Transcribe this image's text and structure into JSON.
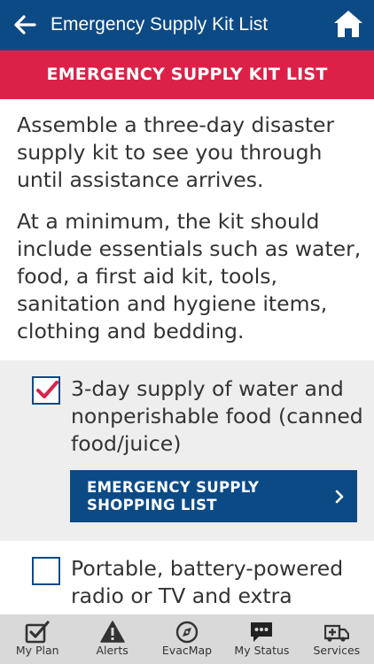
{
  "header": {
    "title": "Emergency Supply Kit List"
  },
  "banner": {
    "text": "EMERGENCY SUPPLY KIT LIST"
  },
  "intro": {
    "paragraph1": "Assemble a three-day disaster supply kit to see you through until assistance arrives.",
    "paragraph2": "At a minimum, the kit should include essentials such as water, food, a first aid kit, tools, sanitation and hygiene items, clothing and bedding."
  },
  "checklist": [
    {
      "text": "3-day supply of water and nonperishable food (canned food/juice)",
      "checked": true,
      "button_label": "EMERGENCY SUPPLY SHOPPING LIST"
    },
    {
      "text": "Portable, battery-powered radio or TV and extra",
      "checked": false
    }
  ],
  "tabs": [
    {
      "label": "My Plan",
      "icon": "my-plan-icon"
    },
    {
      "label": "Alerts",
      "icon": "alert-icon"
    },
    {
      "label": "EvacMap",
      "icon": "compass-icon"
    },
    {
      "label": "My Status",
      "icon": "chat-icon"
    },
    {
      "label": "Services",
      "icon": "ambulance-icon"
    }
  ],
  "colors": {
    "header_blue": "#0c4a86",
    "banner_red": "#db2148",
    "check_red": "#db2148",
    "tabbar_gray": "#d9d9d9"
  }
}
